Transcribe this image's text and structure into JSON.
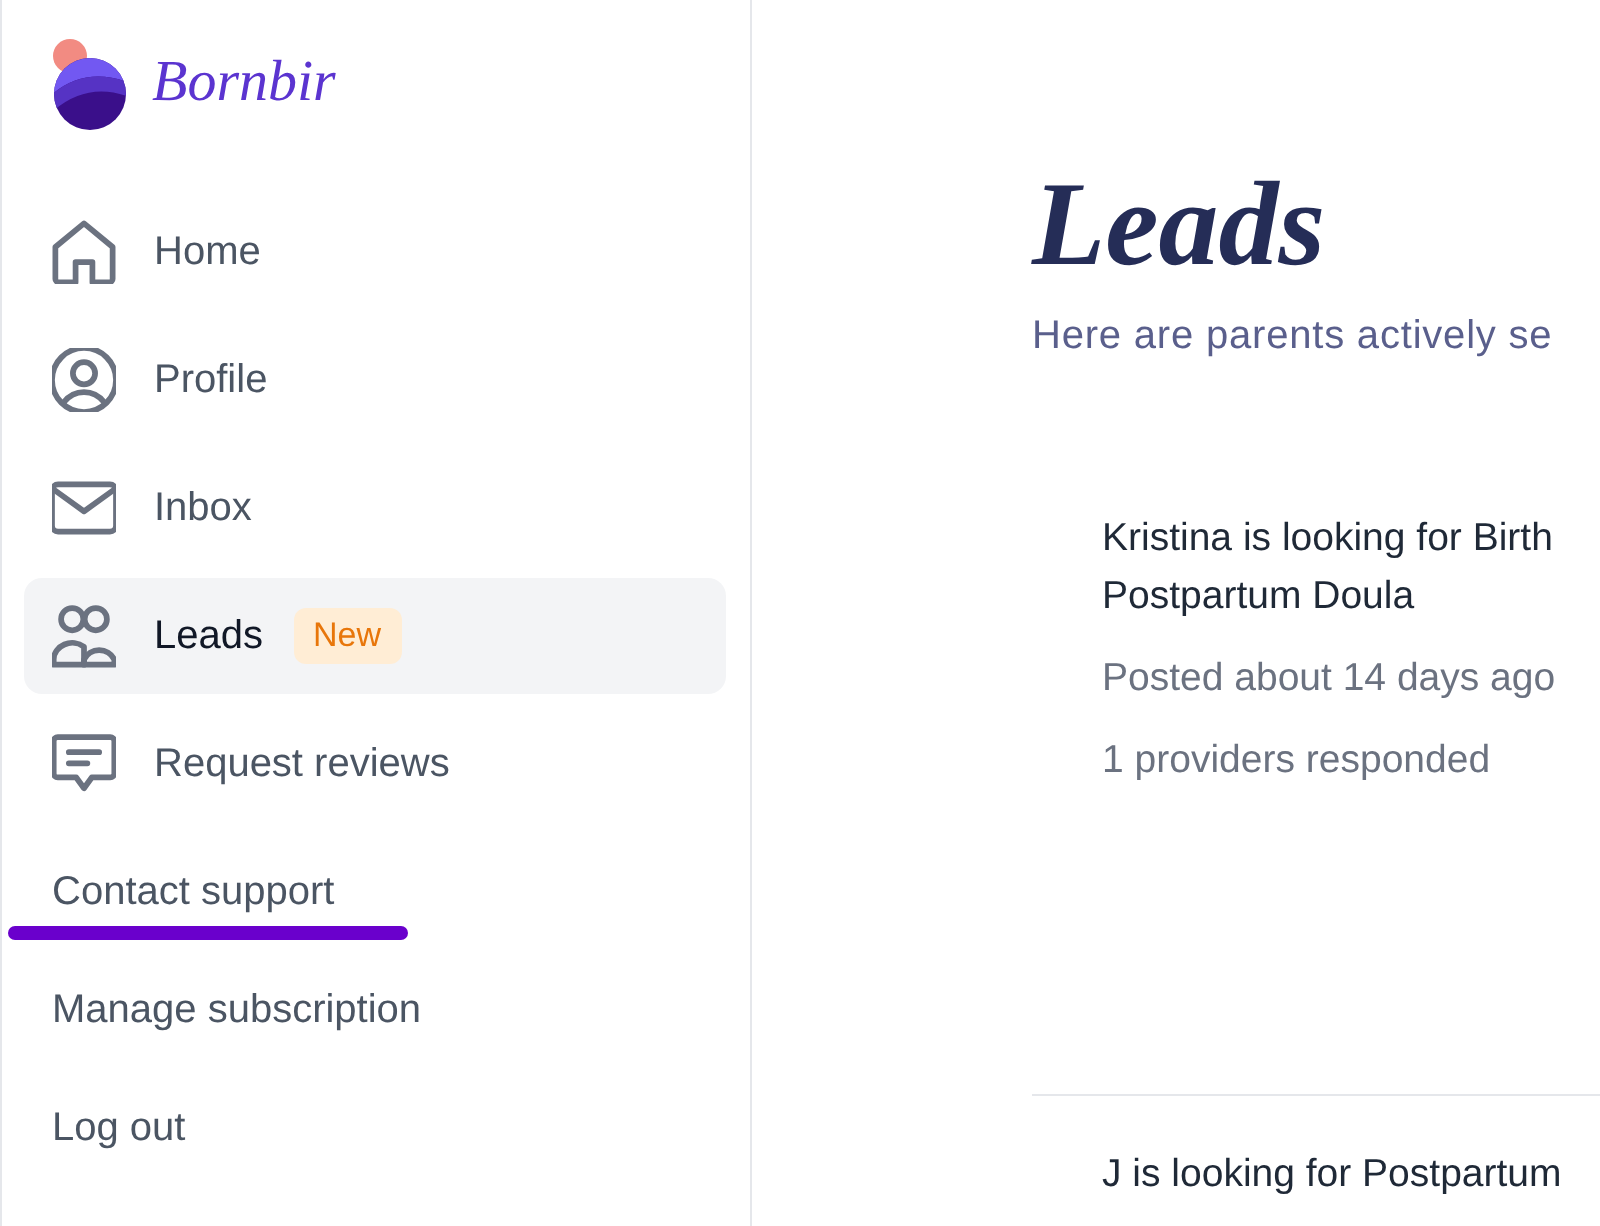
{
  "sidebar": {
    "logo": {
      "name": "Bornbir"
    },
    "nav": [
      {
        "label": "Home",
        "selected": false
      },
      {
        "label": "Profile",
        "selected": false
      },
      {
        "label": "Inbox",
        "selected": false
      },
      {
        "label": "Leads",
        "selected": true,
        "badge": "New"
      },
      {
        "label": "Request reviews",
        "selected": false
      }
    ],
    "links": [
      {
        "label": "Contact support",
        "underlined": true
      },
      {
        "label": "Manage subscription",
        "underlined": false
      },
      {
        "label": "Log out",
        "underlined": false
      }
    ]
  },
  "main": {
    "title": "Leads",
    "subtitle": "Here are parents actively se",
    "leads": [
      {
        "title_lines": [
          "Kristina is looking for Birth",
          "Postpartum Doula"
        ],
        "posted": "Posted about 14 days ago",
        "responses": "1 providers responded"
      },
      {
        "title_lines": [
          "J is looking for Postpartum"
        ]
      }
    ]
  }
}
